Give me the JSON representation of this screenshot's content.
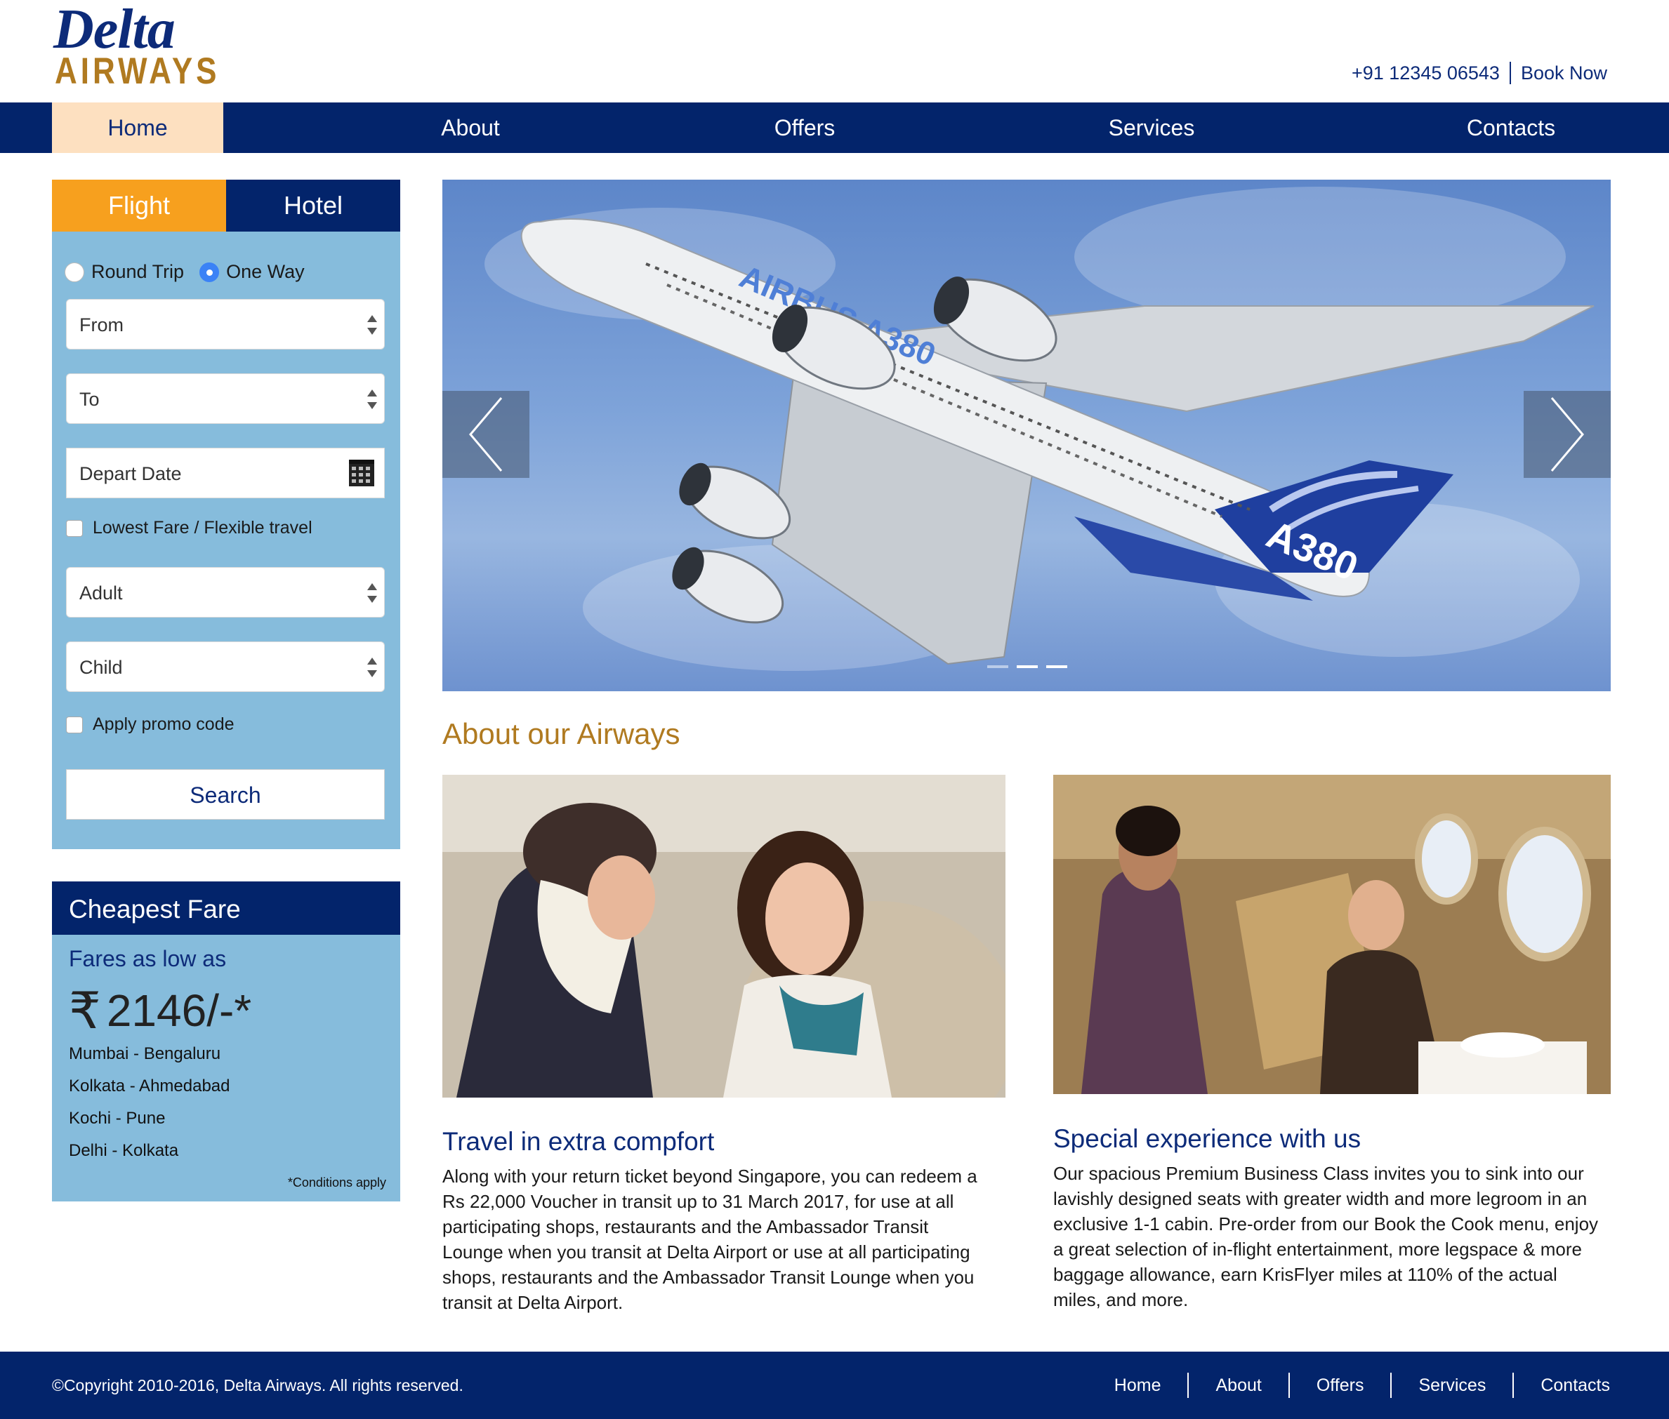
{
  "brand": {
    "name_line1": "Delta",
    "name_line2": "AIRWAYS"
  },
  "header": {
    "phone": "+91 12345 06543",
    "book_now": "Book Now"
  },
  "nav": {
    "items": [
      "Home",
      "About",
      "Offers",
      "Services",
      "Contacts"
    ],
    "active": "Home"
  },
  "booking": {
    "tabs": [
      "Flight",
      "Hotel"
    ],
    "active_tab": "Flight",
    "trip_types": [
      "Round Trip",
      "One Way"
    ],
    "selected_trip": "One Way",
    "from_placeholder": "From",
    "to_placeholder": "To",
    "depart_placeholder": "Depart Date",
    "lowest_fare_label": "Lowest Fare / Flexible travel",
    "adult_placeholder": "Adult",
    "child_placeholder": "Child",
    "promo_label": "Apply promo code",
    "search_label": "Search"
  },
  "fare": {
    "title": "Cheapest Fare",
    "low_label": "Fares as low as",
    "currency_symbol": "₹",
    "price": "2146/-*",
    "routes": [
      "Mumbai - Bengaluru",
      "Kolkata - Ahmedabad",
      "Kochi - Pune",
      "Delhi - Kolkata"
    ],
    "conditions": "*Conditions apply"
  },
  "carousel": {
    "slide_count": 3,
    "active_slide": 2
  },
  "about": {
    "title": "About our Airways",
    "columns": [
      {
        "title": "Travel in extra compfort",
        "lines": [
          "Along with your return ticket beyond Singapore, you can redeem a",
          "Rs 22,000 Voucher in transit up to 31 March 2017, for use at all",
          "participating shops, restaurants and the Ambassador Transit",
          "Lounge when you transit at Delta Airport or use at all participating",
          "shops, restaurants and the Ambassador Transit Lounge when you",
          "transit at Delta Airport."
        ]
      },
      {
        "title": "Special experience with us",
        "lines": [
          "Our spacious Premium Business Class invites you to sink into our",
          "lavishly designed seats with greater width and more legroom in an",
          "exclusive 1-1 cabin. Pre-order from our Book the Cook menu, enjoy",
          "a great selection of in-flight entertainment, more legspace & more",
          "baggage allowance, earn KrisFlyer miles at 110% of the actual",
          "miles, and more."
        ]
      }
    ]
  },
  "footer": {
    "copyright": "©Copyright 2010-2016, Delta Airways. All rights reserved.",
    "links": [
      "Home",
      "About",
      "Offers",
      "Services",
      "Contacts"
    ]
  },
  "colors": {
    "navy": "#03246b",
    "gold": "#b07a20",
    "orange": "#f7a01e",
    "panel": "#86bcdc",
    "active_nav": "#fde0c0"
  },
  "icons": [
    "calendar-icon",
    "chevron-left-icon",
    "chevron-right-icon",
    "rupee-icon"
  ]
}
